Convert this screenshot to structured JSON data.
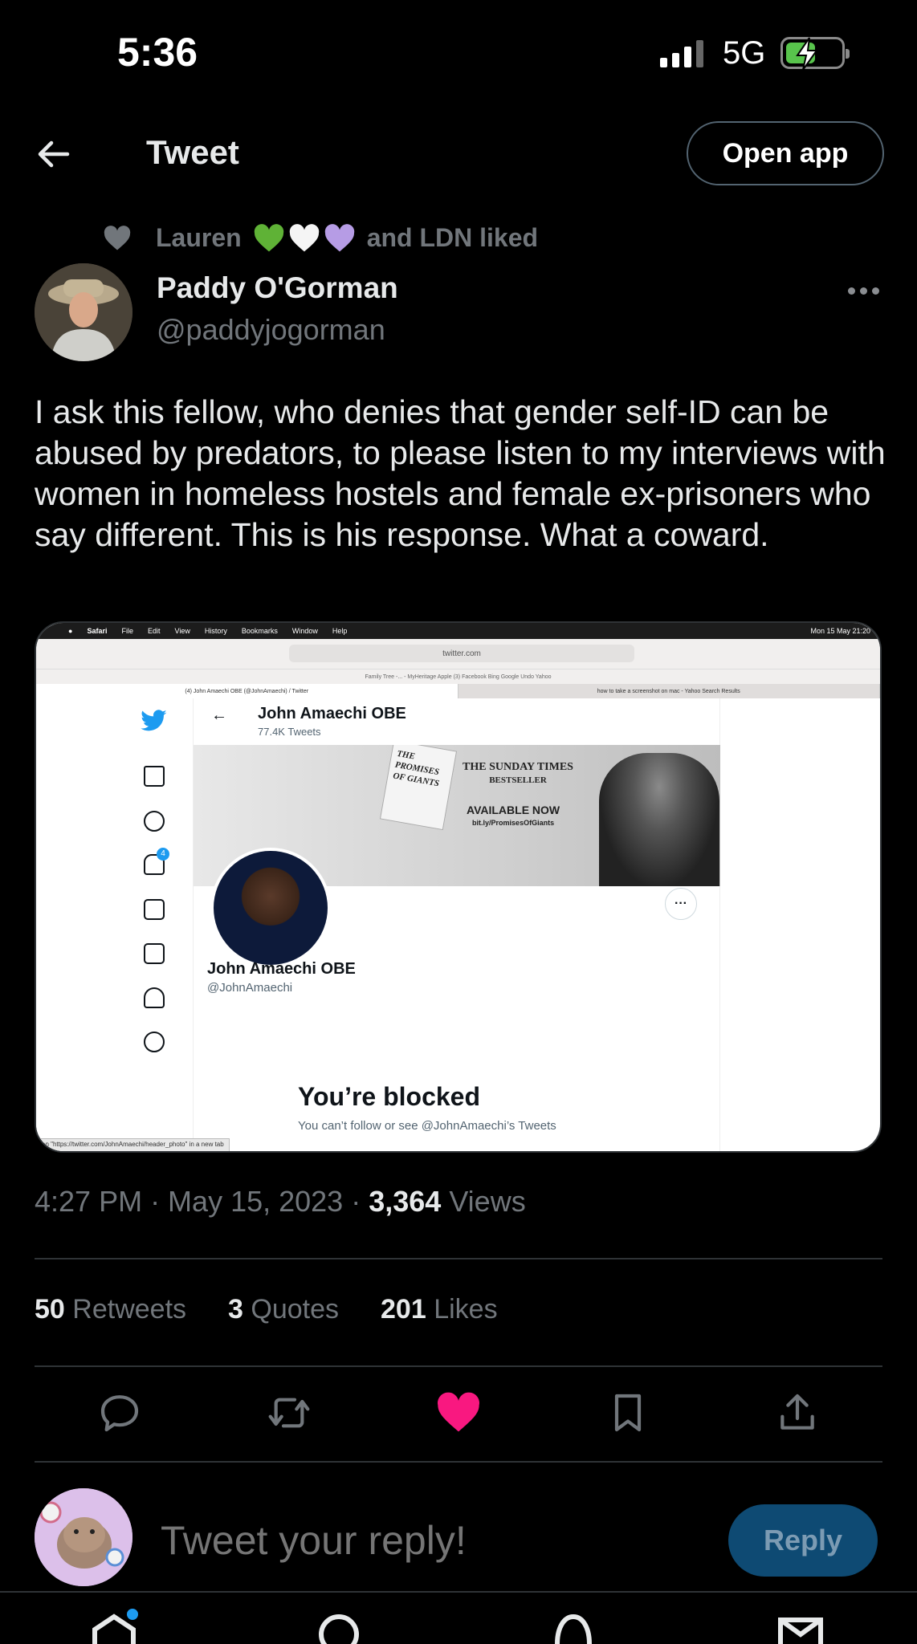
{
  "status_bar": {
    "time": "5:36",
    "network": "5G"
  },
  "header": {
    "title": "Tweet",
    "open_app": "Open app"
  },
  "social_context": {
    "prefix": "Lauren",
    "hearts": [
      "#5fb236",
      "#ffffff",
      "#b69ce5"
    ],
    "suffix": "and LDN liked"
  },
  "tweet": {
    "author_name": "Paddy O'Gorman",
    "author_handle": "@paddyjogorman",
    "text": "I ask this fellow, who denies that gender self-ID can be abused by predators, to please listen to my interviews with women in homeless hostels and female ex-prisoners who say different. This is his response. What a coward.",
    "timestamp": "4:27 PM · May 15, 2023 · ",
    "views_count": "3,364",
    "views_label": "Views"
  },
  "media": {
    "menu_items": [
      "Safari",
      "File",
      "Edit",
      "View",
      "History",
      "Bookmarks",
      "Window",
      "Help"
    ],
    "menu_clock": "Mon 15 May 21:20",
    "url": "twitter.com",
    "favorites": "Family Tree -... - MyHeritage    Apple    (3) Facebook    Bing    Google    Undo    Yahoo",
    "tab_active": "(4) John Amaechi OBE (@JohnAmaechi) / Twitter",
    "tab_inactive": "how to take a screenshot on mac - Yahoo Search Results",
    "profile_name": "John Amaechi OBE",
    "profile_tweets": "77.4K Tweets",
    "book_text": "THE PROMISES OF GIANTS",
    "banner_line1": "THE SUNDAY TIMES",
    "banner_line2": "BESTSELLER",
    "banner_avail": "AVAILABLE NOW",
    "banner_link": "bit.ly/PromisesOfGiants",
    "display_name": "John Amaechi OBE",
    "handle": "@JohnAmaechi",
    "notif_count": "4",
    "blocked_title": "You’re blocked",
    "blocked_sub": "You can’t follow or see @JohnAmaechi’s Tweets",
    "status_url": "en \"https://twitter.com/JohnAmaechi/header_photo\" in a new tab"
  },
  "stats": {
    "retweets_count": "50",
    "retweets_label": "Retweets",
    "quotes_count": "3",
    "quotes_label": "Quotes",
    "likes_count": "201",
    "likes_label": "Likes"
  },
  "colors": {
    "like": "#f91880",
    "accent": "#1d9bf0",
    "reply_button": "#0e4a73"
  },
  "reply": {
    "placeholder": "Tweet your reply!",
    "button": "Reply"
  }
}
